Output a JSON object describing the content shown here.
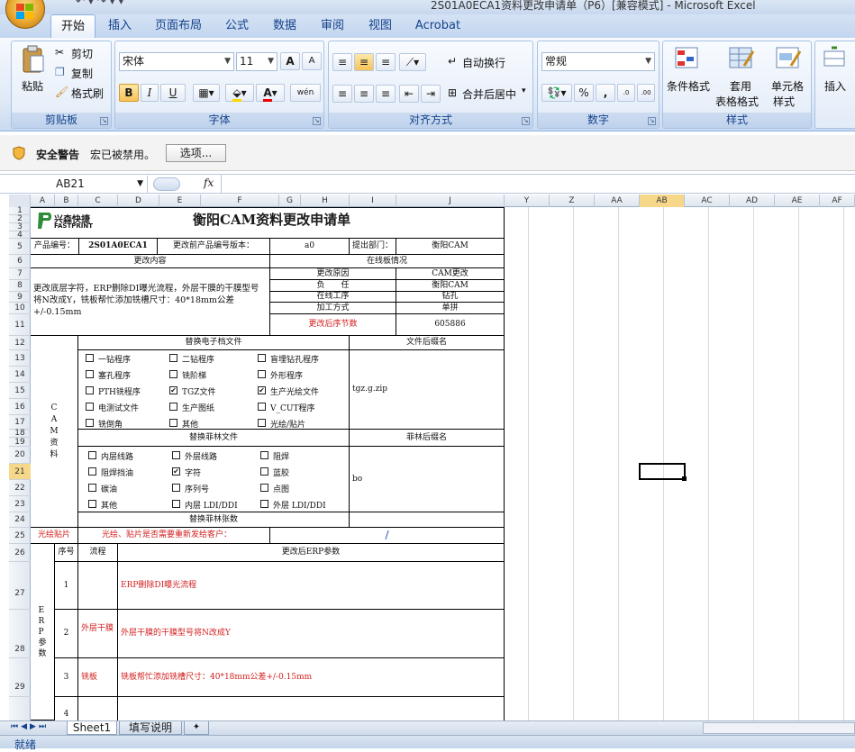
{
  "window": {
    "title": "2S01A0ECA1资料更改申请单（P6）[兼容模式] - Microsoft Excel",
    "qat": "↶ ▾  ↷ ▾  ▾"
  },
  "tabs": [
    "开始",
    "插入",
    "页面布局",
    "公式",
    "数据",
    "审阅",
    "视图",
    "Acrobat"
  ],
  "ribbon": {
    "clipboard": {
      "paste": "粘贴",
      "cut": "剪切",
      "copy": "复制",
      "format_painter": "格式刷",
      "label": "剪贴板"
    },
    "font": {
      "name": "宋体",
      "size": "11",
      "grow": "A",
      "shrink": "A",
      "bold": "B",
      "italic": "I",
      "underline": "U",
      "phonetic": "wén",
      "label": "字体"
    },
    "alignment": {
      "wrap": "自动换行",
      "merge": "合并后居中",
      "label": "对齐方式"
    },
    "number": {
      "format": "常规",
      "percent": "%",
      "comma": ",",
      "inc": ".0←.00",
      "dec": ".00→.0",
      "label": "数字"
    },
    "styles": {
      "cond": "条件格式",
      "table1": "套用",
      "table2": "表格格式",
      "cell1": "单元格",
      "cell2": "样式",
      "label": "样式"
    },
    "cells": {
      "insert": "插入"
    }
  },
  "security": {
    "title": "安全警告",
    "message": "宏已被禁用。",
    "options": "选项..."
  },
  "formula_bar": {
    "namebox": "AB21",
    "fx": "fx",
    "content": ""
  },
  "columns": [
    "A",
    "B",
    "C",
    "D",
    "E",
    "F",
    "G",
    "H",
    "I",
    "J",
    "Y",
    "Z",
    "AA",
    "AB",
    "AC",
    "AD",
    "AE",
    "AF"
  ],
  "rows": [
    "1",
    "2",
    "3",
    "4",
    "5",
    "6",
    "7",
    "8",
    "9",
    "10",
    "11",
    "12",
    "13",
    "14",
    "15",
    "16",
    "17",
    "18",
    "19",
    "20",
    "21",
    "22",
    "23",
    "24",
    "25",
    "26",
    "27",
    "28",
    "29"
  ],
  "form": {
    "logo_cn": "兴森快捷",
    "logo_en": "FASTPRINT",
    "title": "衡阳CAM资料更改申请单",
    "prod_no_label": "产品编号：",
    "prod_no": "2S01A0ECA1",
    "prev_ver_label": "更改前产品编号版本：",
    "prev_ver": "a0",
    "dept_label": "提出部门：",
    "dept": "衡阳CAM",
    "change_content": "更改内容",
    "online_status": "在线板情况",
    "description": "更改底层字符，ERP删除DI曝光流程，外层干膜的干膜型号将N改成Y，铣板帮忙添加铣槽尺寸：40*18mm公差+/-0.15mm",
    "reason_label": "更改原因",
    "reason": "CAM更改",
    "owner_label": "负　　任",
    "owner": "衡阳CAM",
    "process_label": "在线工序",
    "process": "钻孔",
    "method_label": "加工方式",
    "method": "单拼",
    "after_label": "更改后序节数",
    "after": "605886",
    "cam_vertical": "C A M 资 料",
    "replace_files": "替换电子档文件",
    "file_suffix": "文件后缀名",
    "files": [
      {
        "a": "一钻程序",
        "a_c": false,
        "b": "二钻程序",
        "b_c": false,
        "c": "盲埋钻孔程序",
        "c_c": false
      },
      {
        "a": "塞孔程序",
        "a_c": false,
        "b": "铣阶梯",
        "b_c": false,
        "c": "外形程序",
        "c_c": false
      },
      {
        "a": "PTH铣程序",
        "a_c": false,
        "b": "TGZ文件",
        "b_c": true,
        "c": "生产光绘文件",
        "c_c": true
      },
      {
        "a": "电测试文件",
        "a_c": false,
        "b": "生产图纸",
        "b_c": false,
        "c": "V_CUT程序",
        "c_c": false
      },
      {
        "a": "铣倒角",
        "a_c": false,
        "b": "其他",
        "b_c": false,
        "c": "光绘/贴片",
        "c_c": false
      }
    ],
    "file_suffix_val": "tgz.g.zip",
    "replace_film": "替换菲林文件",
    "film_suffix": "菲林后缀名",
    "films": [
      {
        "a": "内层线路",
        "a_c": false,
        "b": "外层线路",
        "b_c": false,
        "c": "阻焊",
        "c_c": false
      },
      {
        "a": "阻焊挡油",
        "a_c": false,
        "b": "字符",
        "b_c": true,
        "c": "蓝胶",
        "c_c": false
      },
      {
        "a": "碳油",
        "a_c": false,
        "b": "序列号",
        "b_c": false,
        "c": "点图",
        "c_c": false
      },
      {
        "a": "其他",
        "a_c": false,
        "b": "内层 LDI/DDI",
        "b_c": false,
        "c": "外层 LDI/DDI",
        "c_c": false
      }
    ],
    "film_suffix_val": "bo",
    "film_count": "替换菲林张数",
    "photo_label": "光绘贴片",
    "photo_q": "光绘、贴片是否需要重新发给客户：",
    "photo_val": "/",
    "erp_vertical": "E R P 参 数",
    "seq": "序号",
    "flow": "流程",
    "erp_params": "更改后ERP参数",
    "erp_rows": [
      {
        "n": "1",
        "flow": "",
        "param": "ERP删除DI曝光流程"
      },
      {
        "n": "2",
        "flow": "外层干膜",
        "param": "外层干膜的干膜型号将N改成Y"
      },
      {
        "n": "3",
        "flow": "铣板",
        "param": "铣板帮忙添加铣槽尺寸：40*18mm公差+/-0.15mm"
      },
      {
        "n": "4",
        "flow": "",
        "param": ""
      }
    ]
  },
  "sheet_tabs": [
    "Sheet1",
    "填写说明"
  ],
  "status": "就绪"
}
